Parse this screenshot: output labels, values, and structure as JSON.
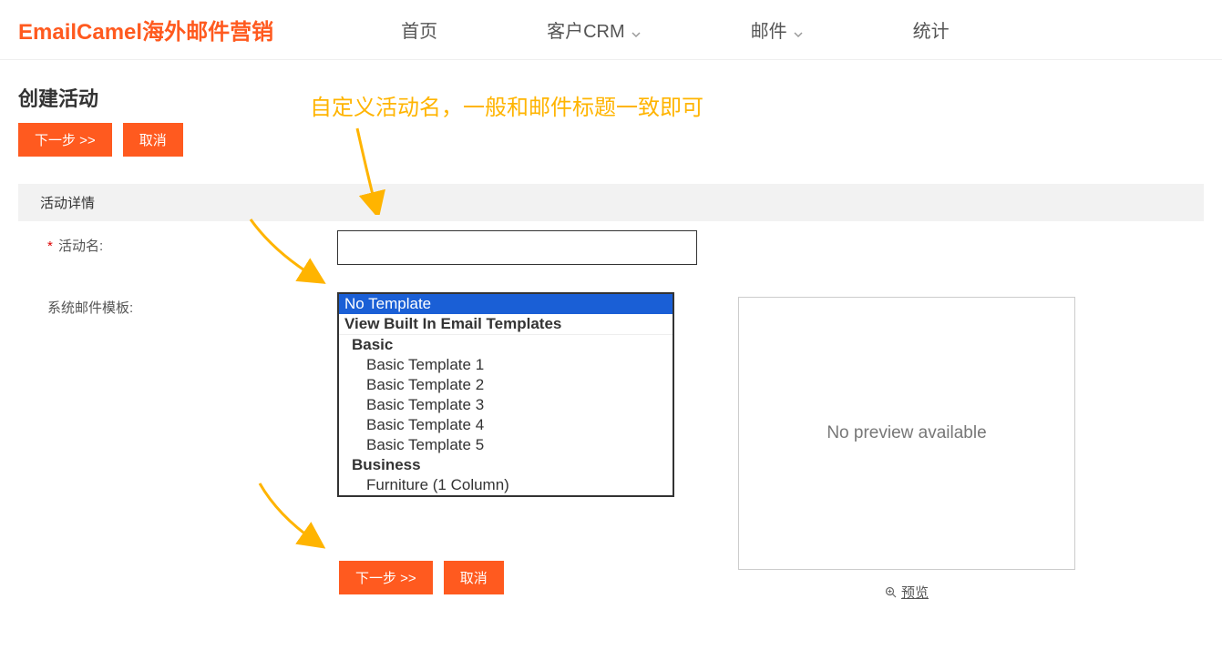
{
  "header": {
    "logo": "EmailCamel海外邮件营销",
    "nav": {
      "home": "首页",
      "crm": "客户CRM",
      "mail": "邮件",
      "stats": "统计"
    }
  },
  "page": {
    "title": "创建活动",
    "next_btn": "下一步 >>",
    "cancel_btn": "取消",
    "annotation": "自定义活动名，一般和邮件标题一致即可"
  },
  "section": {
    "header": "活动详情",
    "activity_name_label": "活动名:",
    "template_label": "系统邮件模板:"
  },
  "templates": {
    "selected": "No Template",
    "view_header": "View Built In Email Templates",
    "group_basic": "Basic",
    "basic1": "Basic Template 1",
    "basic2": "Basic Template 2",
    "basic3": "Basic Template 3",
    "basic4": "Basic Template 4",
    "basic5": "Basic Template 5",
    "group_business": "Business",
    "business1": "Furniture (1 Column)"
  },
  "preview": {
    "placeholder": "No preview available",
    "link": "预览"
  },
  "bottom": {
    "next_btn": "下一步 >>",
    "cancel_btn": "取消"
  }
}
